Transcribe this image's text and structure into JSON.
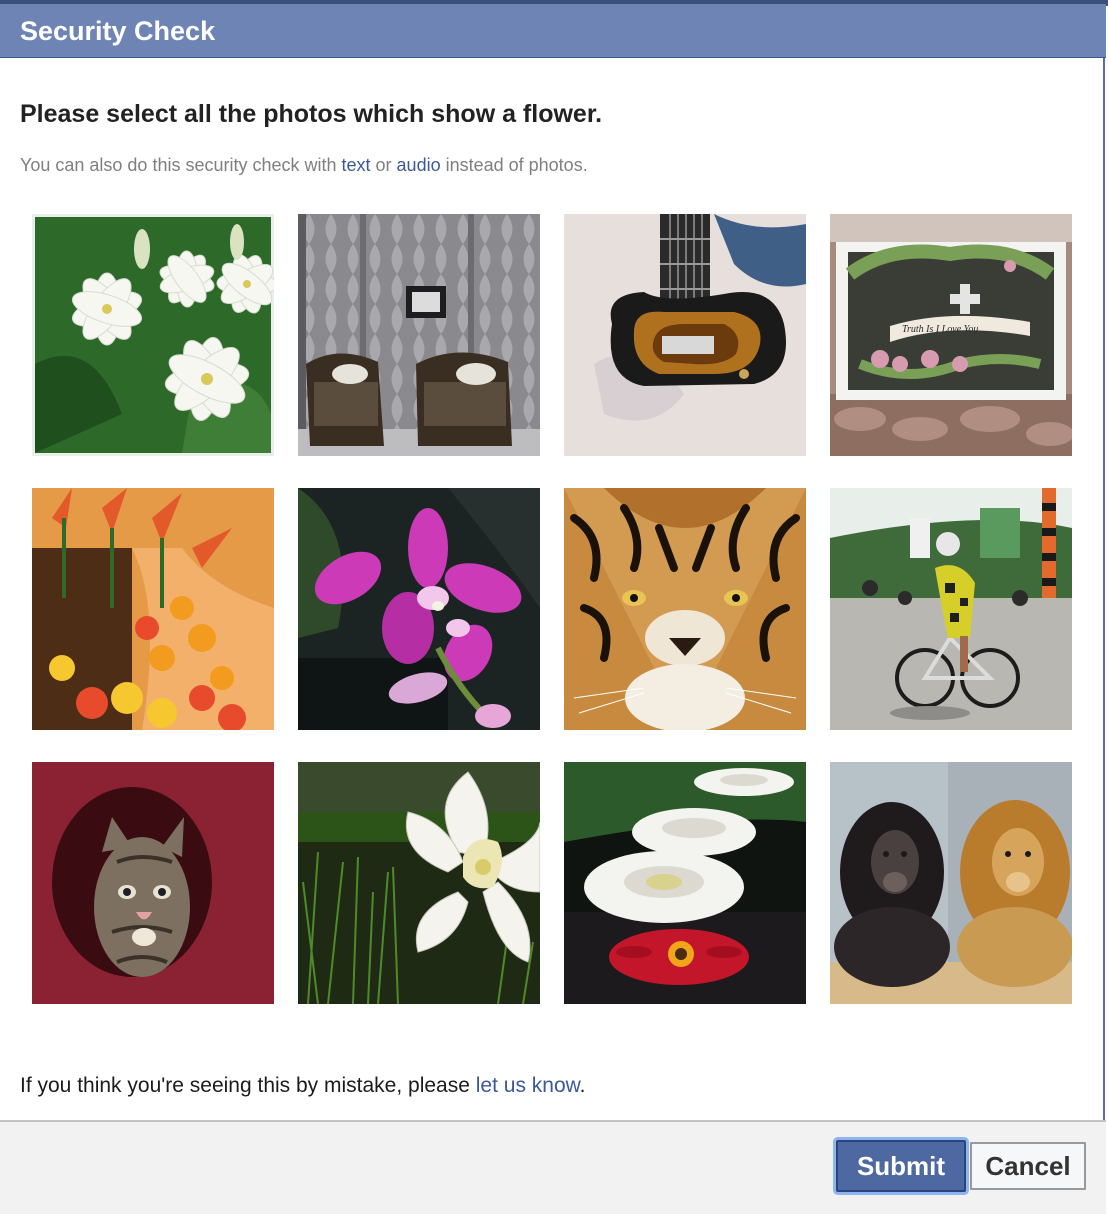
{
  "dialog": {
    "title": "Security Check"
  },
  "instructions": {
    "heading": "Please select all the photos which show a flower.",
    "alt_prefix": "You can also do this security check with ",
    "text_link": "text",
    "or": " or ",
    "audio_link": "audio",
    "alt_suffix": " instead of photos."
  },
  "photos": [
    {
      "subject": "white-jasmine-flowers",
      "row": 1,
      "col": 1
    },
    {
      "subject": "armchairs-and-mirror",
      "row": 1,
      "col": 2
    },
    {
      "subject": "electric-guitar",
      "row": 1,
      "col": 3
    },
    {
      "subject": "framed-wreath-sign",
      "row": 1,
      "col": 4
    },
    {
      "subject": "orange-flowers",
      "row": 2,
      "col": 1
    },
    {
      "subject": "pink-orchid",
      "row": 2,
      "col": 2
    },
    {
      "subject": "tiger-face",
      "row": 2,
      "col": 3
    },
    {
      "subject": "cyclist",
      "row": 2,
      "col": 4
    },
    {
      "subject": "kitten",
      "row": 3,
      "col": 1
    },
    {
      "subject": "white-daffodil",
      "row": 3,
      "col": 2
    },
    {
      "subject": "stacked-daisies",
      "row": 3,
      "col": 3
    },
    {
      "subject": "two-lions",
      "row": 3,
      "col": 4
    }
  ],
  "sign_text": "Truth Is I Love You",
  "footer": {
    "note_prefix": "If you think you're seeing this by mistake, please ",
    "note_link": "let us know",
    "note_suffix": "."
  },
  "buttons": {
    "submit": "Submit",
    "cancel": "Cancel"
  },
  "colors": {
    "titlebar": "#6d84b4",
    "link": "#3b5998",
    "submit_bg": "#4e69a2"
  }
}
